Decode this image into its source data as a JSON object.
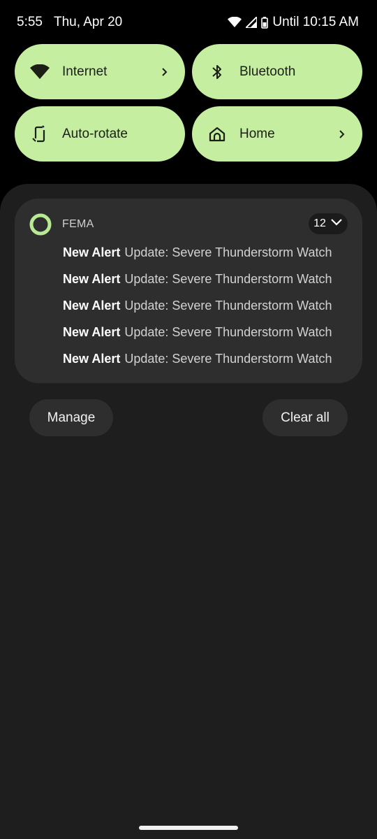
{
  "status_bar": {
    "time": "5:55",
    "date": "Thu, Apr 20",
    "battery_text": "Until 10:15 AM",
    "icons": [
      "wifi-icon",
      "signal-icon",
      "battery-icon"
    ]
  },
  "quick_tiles": [
    {
      "label": "Internet",
      "icon": "wifi-icon",
      "has_chevron": true
    },
    {
      "label": "Bluetooth",
      "icon": "bluetooth-icon",
      "has_chevron": false
    },
    {
      "label": "Auto-rotate",
      "icon": "rotate-icon",
      "has_chevron": false
    },
    {
      "label": "Home",
      "icon": "home-icon",
      "has_chevron": true
    }
  ],
  "notification": {
    "app_name": "FEMA",
    "count": "12",
    "rows": [
      {
        "title": "New Alert",
        "text": "Update: Severe Thunderstorm Watch"
      },
      {
        "title": "New Alert",
        "text": "Update: Severe Thunderstorm Watch"
      },
      {
        "title": "New Alert",
        "text": "Update: Severe Thunderstorm Watch"
      },
      {
        "title": "New Alert",
        "text": "Update: Severe Thunderstorm Watch"
      },
      {
        "title": "New Alert",
        "text": "Update: Severe Thunderstorm Watch"
      }
    ]
  },
  "actions": {
    "manage_label": "Manage",
    "clear_all_label": "Clear all"
  },
  "colors": {
    "tile_bg": "#c5eea1",
    "shade_bg": "#1e1e1e",
    "card_bg": "#2e2e2e",
    "accent": "#b8e994"
  }
}
